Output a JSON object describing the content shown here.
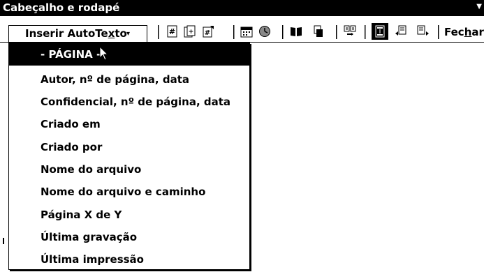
{
  "window": {
    "title": "Cabeçalho e rodapé"
  },
  "toolbar": {
    "insert_autotext": {
      "prefix": "Inserir AutoTe",
      "hotkey": "x",
      "suffix": "to",
      "caret": "▾"
    },
    "close_prefix": "Fec",
    "close_hotkey": "h",
    "close_suffix": "ar",
    "icons": [
      "insert-page-number-icon",
      "insert-number-of-pages-icon",
      "format-page-number-icon",
      "insert-date-icon",
      "insert-time-icon",
      "page-setup-icon",
      "show-hide-document-text-icon",
      "same-as-previous-icon",
      "switch-header-footer-icon",
      "show-previous-icon",
      "show-next-icon"
    ]
  },
  "menu": {
    "items": [
      {
        "label": "- PÁGINA -",
        "selected": true
      },
      {
        "label": "Autor, nº de página, data"
      },
      {
        "label": "Confidencial, nº de página, data"
      },
      {
        "label": "Criado em"
      },
      {
        "label": "Criado por"
      },
      {
        "label": "Nome do arquivo"
      },
      {
        "label": "Nome do arquivo e caminho"
      },
      {
        "label": "Página X de Y"
      },
      {
        "label": "Última gravação"
      },
      {
        "label": "Última impressão"
      }
    ]
  }
}
